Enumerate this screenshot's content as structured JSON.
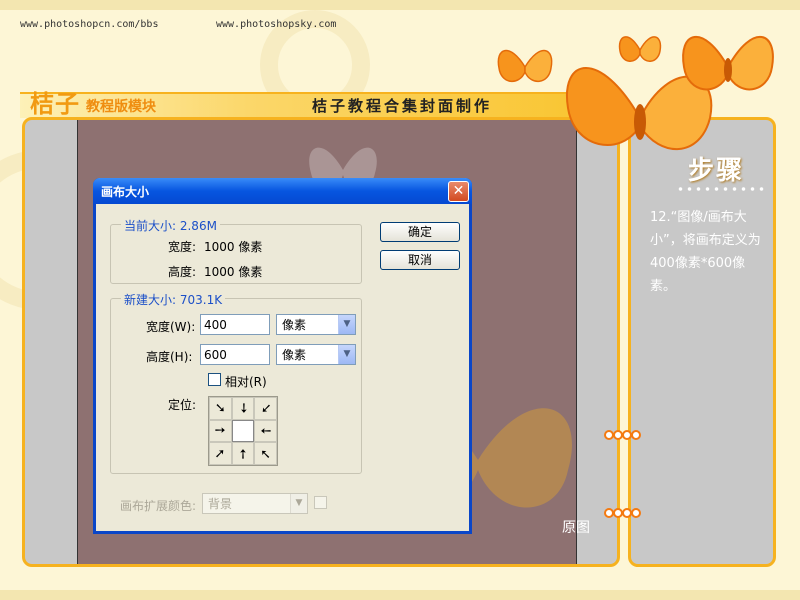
{
  "header": {
    "url_left": "www.photoshopcn.com/bbs",
    "url_right": "www.photoshopsky.com",
    "logo_main": "桔子",
    "logo_sub": "教程版模块",
    "title": "桔子教程合集封面制作"
  },
  "side": {
    "title": "步骤",
    "step_text": "12.“图像/画布大小”，将画布定义为400像素*600像素。"
  },
  "canvas": {
    "original_label": "原图"
  },
  "dialog": {
    "title": "画布大小",
    "close_glyph": "✕",
    "current_size_legend": "当前大小: 2.86M",
    "current_width_label": "宽度:",
    "current_width_value": "1000 像素",
    "current_height_label": "高度:",
    "current_height_value": "1000 像素",
    "new_size_legend": "新建大小: 703.1K",
    "width_label": "宽度(W):",
    "width_value": "400",
    "width_unit": "像素",
    "height_label": "高度(H):",
    "height_value": "600",
    "height_unit": "像素",
    "relative_label": "相对(R)",
    "anchor_label": "定位:",
    "anchor_arrows": [
      "➘",
      "➘",
      "➘",
      "➘",
      "",
      "➘",
      "➘",
      "➘",
      "➘"
    ],
    "extension_color_label": "画布扩展颜色:",
    "extension_color_value": "背景",
    "ok_label": "确定",
    "cancel_label": "取消",
    "dropdown_glyph": "▼"
  },
  "colors": {
    "accent_orange": "#f6b21f",
    "canvas_brown": "#8e7171",
    "dialog_blue": "#0a46c8"
  }
}
